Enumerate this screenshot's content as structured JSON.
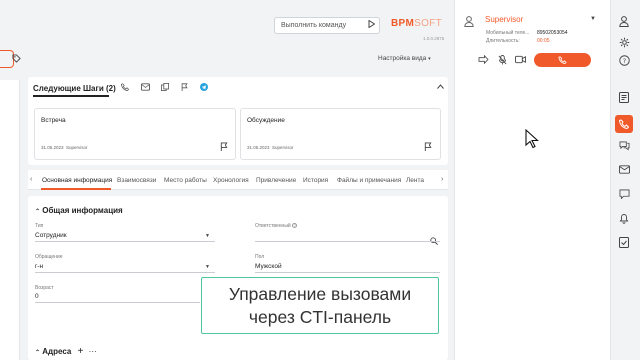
{
  "header": {
    "command_placeholder": "Выполнить команду",
    "logo_main": "BPM",
    "logo_soft": "SOFT",
    "version": "1.0.0.2875",
    "view_settings": "Настройка вида"
  },
  "next_steps": {
    "title": "Следующие Шаги (2)",
    "cards": [
      {
        "title": "Встреча",
        "date": "31.05.2023",
        "owner": "Supervisor"
      },
      {
        "title": "Обсуждение",
        "date": "31.05.2023",
        "owner": "Supervisor"
      }
    ]
  },
  "tabs": [
    "Основная информация",
    "Взаимосвязи",
    "Место работы",
    "Хронология",
    "Привлечение",
    "История",
    "Файлы и примечания",
    "Лента"
  ],
  "general_info": {
    "title": "Общая информация",
    "fields": [
      {
        "label": "Тип",
        "value": "Сотрудник"
      },
      {
        "label": "Ответственный",
        "value": ""
      },
      {
        "label": "Обращение",
        "value": "г-н"
      },
      {
        "label": "Пол",
        "value": "Мужской"
      },
      {
        "label": "Возраст",
        "value": "0"
      }
    ]
  },
  "addresses": {
    "title": "Адреса"
  },
  "caption": {
    "line1": "Управление вызовами",
    "line2": "через CTI-панель"
  },
  "cti": {
    "agent_name": "Supervisor",
    "mobile_label": "Мобильный теле...",
    "mobile_value": "89502053054",
    "duration_label": "Длительность:",
    "duration_value": "00:05"
  },
  "colors": {
    "accent": "#f05a2a",
    "caption_border": "#4fc79b"
  }
}
